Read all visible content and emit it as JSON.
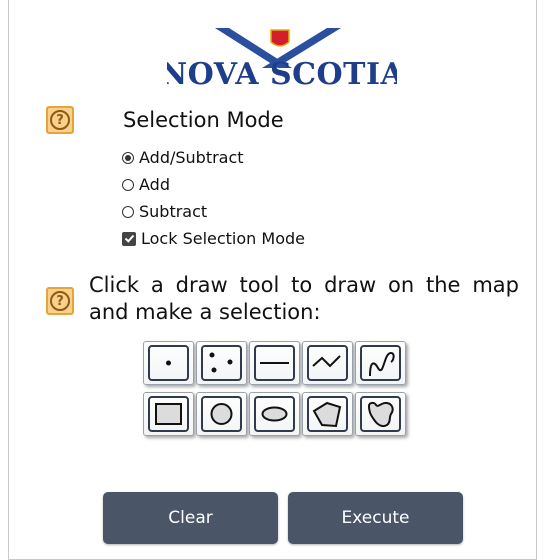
{
  "logo": {
    "text": "NOVA SCOTIA",
    "icon": "nova-scotia-flag-wings"
  },
  "help_icons": [
    "help-icon",
    "help-icon"
  ],
  "selection": {
    "title": "Selection Mode",
    "options": [
      {
        "label": "Add/Subtract",
        "selected": true
      },
      {
        "label": "Add",
        "selected": false
      },
      {
        "label": "Subtract",
        "selected": false
      }
    ],
    "lock_label": "Lock Selection Mode",
    "lock_checked": true
  },
  "instruction": "Click a draw tool to draw on the map and make a selection:",
  "tools": {
    "row1": [
      "point-tool",
      "multipoint-tool",
      "line-tool",
      "polyline-tool",
      "freehand-line-tool"
    ],
    "row2": [
      "rectangle-tool",
      "circle-tool",
      "ellipse-tool",
      "polygon-tool",
      "freehand-polygon-tool"
    ]
  },
  "buttons": {
    "clear": "Clear",
    "execute": "Execute"
  },
  "colors": {
    "button_bg": "#4a5668",
    "help_bg": "#fbd08d",
    "logo_blue": "#1f3e8a",
    "logo_red": "#d31f2d"
  }
}
